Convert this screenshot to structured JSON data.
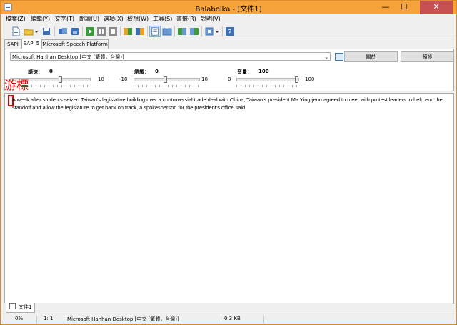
{
  "window": {
    "title": "Balabolka - [文件1]",
    "minimize": "—",
    "maximize": "☐",
    "close": "✕"
  },
  "menu": [
    "檔案(Z)",
    "編輯(Y)",
    "文字(T)",
    "朗讀(U)",
    "選項(X)",
    "檢視(W)",
    "工具(S)",
    "書籤(R)",
    "說明(V)"
  ],
  "toolbar_icons": [
    "new-document-icon",
    "open-folder-icon",
    "dropdown-arrow-icon",
    "save-icon",
    "convert-icon",
    "export-icon",
    "play-icon",
    "pause-icon",
    "stop-icon",
    "voice-a-icon",
    "voice-b-icon",
    "text-view-icon",
    "book-icon",
    "book-prev-icon",
    "book-next-icon",
    "clip-icon",
    "dropdown-arrow-icon",
    "help-icon"
  ],
  "engine_tabs": [
    "SAPI 4",
    "SAPI 5",
    "Microsoft Speech Platform"
  ],
  "engine_tab_selected": 1,
  "voice": {
    "selected": "Microsoft Hanhan Desktop [中文 (繁體，台灣)]",
    "about_button": "關於",
    "default_button": "預設"
  },
  "sliders": {
    "rate": {
      "label": "語速：",
      "value": "0",
      "min": "",
      "max": "10",
      "fraction": 0.5
    },
    "pitch": {
      "label": "語調：",
      "value": "0",
      "min": "-10",
      "max": "10",
      "fraction": 0.5
    },
    "volume": {
      "label": "音量：",
      "value": "100",
      "min": "0",
      "max": "100",
      "fraction": 1.0
    }
  },
  "annotation": "游標",
  "editor": {
    "first_char": "A",
    "text": " week after students seized Taiwan's legislative building over a controversial trade deal with China, Taiwan's president Ma Ying-jeou agreed to meet with protest leaders to help end the standoff and allow the legislature to get back on track, a spokesperson for the president's office said"
  },
  "doc_tab": "文件1",
  "status": {
    "progress": "0%",
    "position": "1:   1",
    "voice": "Microsoft Hanhan Desktop [中文 (繁體，台灣)]",
    "size": "0.3 KB"
  },
  "colors": {
    "titlebar": "#f6a33c",
    "close_button": "#c75050",
    "annotation_red": "#e00000"
  }
}
